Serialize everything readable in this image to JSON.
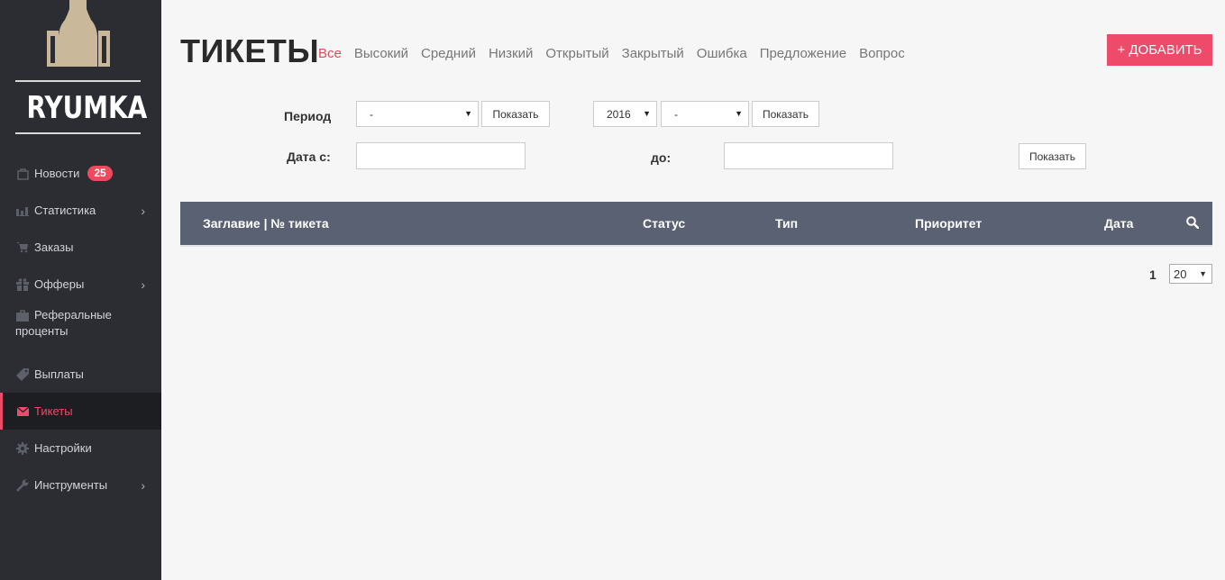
{
  "brand": {
    "logo_text": "RYUMKA"
  },
  "sidebar": {
    "items": [
      {
        "label": "Новости",
        "icon": "bag-icon",
        "badge": "25"
      },
      {
        "label": "Статистика",
        "icon": "bar-chart-icon",
        "has_submenu": true
      },
      {
        "label": "Заказы",
        "icon": "cart-icon"
      },
      {
        "label": "Офферы",
        "icon": "gift-icon",
        "has_submenu": true
      },
      {
        "label": "Реферальные проценты",
        "line1": "Реферальные",
        "line2": "проценты",
        "icon": "briefcase-icon"
      },
      {
        "label": "Выплаты",
        "icon": "tag-icon"
      },
      {
        "label": "Тикеты",
        "icon": "envelope-icon",
        "active": true
      },
      {
        "label": "Настройки",
        "icon": "gear-icon"
      },
      {
        "label": "Инструменты",
        "icon": "wrench-icon",
        "has_submenu": true
      }
    ],
    "chevron": "›"
  },
  "page": {
    "title": "ТИКЕТЫ"
  },
  "filters": [
    "Все",
    "Высокий",
    "Средний",
    "Низкий",
    "Открытый",
    "Закрытый",
    "Ошибка",
    "Предложение",
    "Вопрос"
  ],
  "add_button": "+ ДОБАВИТЬ",
  "period": {
    "label": "Период",
    "select_value": "-",
    "show_label": "Показать",
    "year_value": "2016",
    "month_value": "-",
    "show_label_2": "Показать"
  },
  "date_range": {
    "from_label": "Дата с:",
    "from_value": "",
    "to_label": "до:",
    "to_value": "",
    "show_label": "Показать"
  },
  "table": {
    "columns": [
      "Заглавие | № тикета",
      "Статус",
      "Тип",
      "Приоритет",
      "Дата"
    ],
    "rows": []
  },
  "pagination": {
    "current_page": "1",
    "per_page": "20"
  },
  "colors": {
    "accent": "#ee4a6a",
    "sidebar_bg": "#2b2d33",
    "table_header": "#5a6172"
  }
}
